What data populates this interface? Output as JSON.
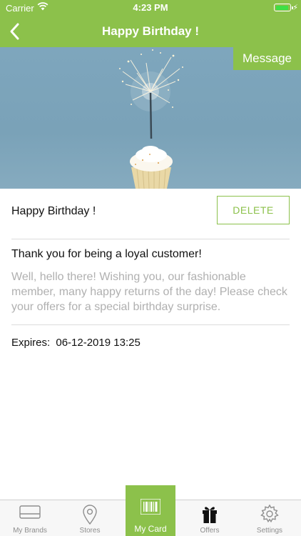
{
  "status_bar": {
    "carrier": "Carrier",
    "time": "4:23 PM"
  },
  "nav": {
    "title": "Happy Birthday !"
  },
  "hero": {
    "tag": "Message"
  },
  "offer": {
    "title": "Happy Birthday !",
    "delete_label": "DELETE",
    "headline": "Thank you for being a loyal customer!",
    "body": "Well, hello there! Wishing you, our fashionable member, many happy returns of the day! Please check your offers for a special birthday surprise.",
    "expires_label": "Expires:",
    "expires_value": "06-12-2019 13:25"
  },
  "tabs": [
    {
      "label": "My Brands",
      "icon": "card-icon"
    },
    {
      "label": "Stores",
      "icon": "location-pin-icon"
    },
    {
      "label": "My Card",
      "icon": "barcode-icon"
    },
    {
      "label": "Offers",
      "icon": "gift-icon"
    },
    {
      "label": "Settings",
      "icon": "gear-icon"
    }
  ],
  "colors": {
    "accent": "#8cc14b",
    "muted_text": "#b0b0b0"
  }
}
